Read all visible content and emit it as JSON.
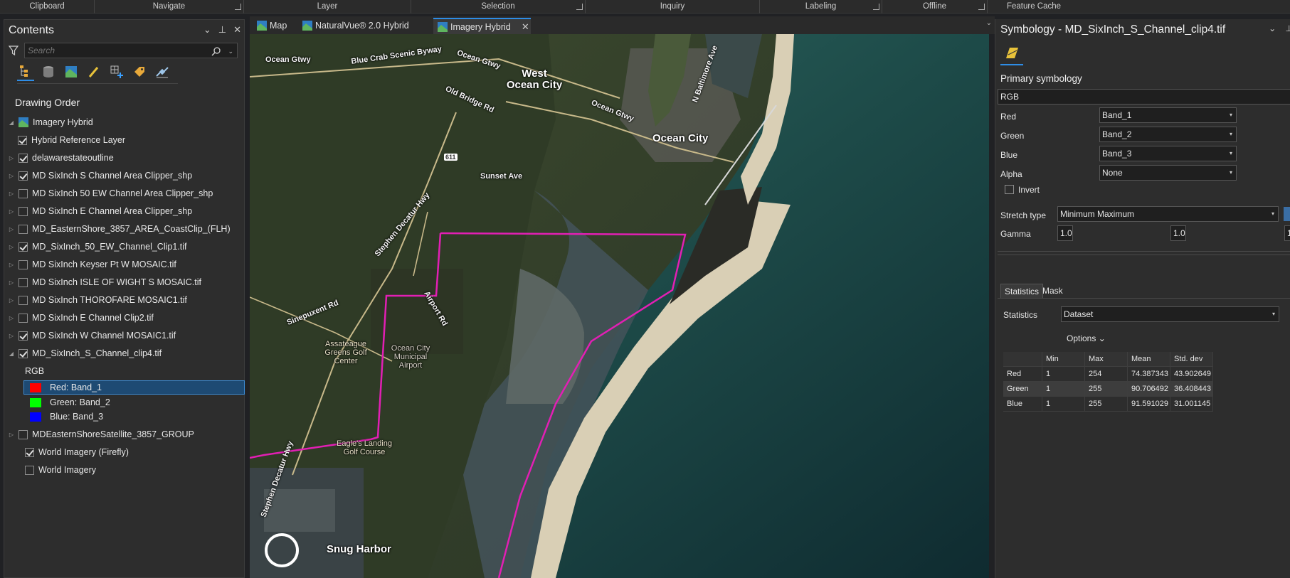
{
  "ribbon": {
    "groups": [
      "Clipboard",
      "Navigate",
      "Layer",
      "Selection",
      "Inquiry",
      "Labeling",
      "Offline",
      "Feature Cache"
    ]
  },
  "contents": {
    "title": "Contents",
    "search_placeholder": "Search",
    "heading": "Drawing Order",
    "layers": [
      {
        "label": "Imagery Hybrid",
        "kind": "map",
        "expand": "collapse"
      },
      {
        "label": "Hybrid Reference Layer",
        "checked": true
      },
      {
        "label": "delawarestateoutline",
        "checked": true,
        "expand": "expand"
      },
      {
        "label": "MD SixInch S Channel Area Clipper_shp",
        "checked": true,
        "expand": "expand"
      },
      {
        "label": "MD SixInch 50 EW Channel Area Clipper_shp",
        "checked": false,
        "expand": "expand"
      },
      {
        "label": "MD SixInch E Channel Area Clipper_shp",
        "checked": false,
        "expand": "expand"
      },
      {
        "label": "MD_EasternShore_3857_AREA_CoastClip_(FLH)",
        "checked": false,
        "expand": "expand"
      },
      {
        "label": "MD_SixInch_50_EW_Channel_Clip1.tif",
        "checked": true,
        "expand": "expand"
      },
      {
        "label": "MD SixInch Keyser Pt W MOSAIC.tif",
        "checked": false,
        "expand": "expand"
      },
      {
        "label": "MD SixInch ISLE OF WIGHT S MOSAIC.tif",
        "checked": false,
        "expand": "expand"
      },
      {
        "label": "MD SixInch THOROFARE MOSAIC1.tif",
        "checked": false,
        "expand": "expand"
      },
      {
        "label": "MD SixInch E Channel Clip2.tif",
        "checked": false,
        "expand": "expand"
      },
      {
        "label": "MD SixInch W Channel MOSAIC1.tif",
        "checked": true,
        "expand": "expand"
      },
      {
        "label": "MD_SixInch_S_Channel_clip4.tif",
        "checked": true,
        "expand": "collapse"
      }
    ],
    "rgb_label": "RGB",
    "bands": [
      {
        "label": "Red:   Band_1",
        "color": "#ff0000",
        "selected": true
      },
      {
        "label": "Green: Band_2",
        "color": "#00ff00",
        "selected": false
      },
      {
        "label": "Blue:  Band_3",
        "color": "#0000ff",
        "selected": false
      }
    ],
    "more_layers": [
      {
        "label": "MDEasternShoreSatellite_3857_GROUP",
        "checked": false,
        "expand": "expand"
      },
      {
        "label": "World Imagery (Firefly)",
        "checked": true
      },
      {
        "label": "World Imagery",
        "checked": false
      }
    ]
  },
  "map_tabs": [
    {
      "label": "Map",
      "active": false
    },
    {
      "label": "NaturalVue® 2.0 Hybrid",
      "active": false
    },
    {
      "label": "Imagery Hybrid",
      "active": true
    }
  ],
  "map_labels": {
    "ocean_gtwy_1": "Ocean Gtwy",
    "blue_crab": "Blue Crab Scenic Byway",
    "ocean_gtwy_2": "Ocean Gtwy",
    "west_ocean_city": "West Ocean City",
    "old_bridge": "Old Bridge Rd",
    "ocean_gtwy_3": "Ocean Gtwy",
    "ocean_city": "Ocean City",
    "baltimore_ave": "N Baltimore Ave",
    "route_611": "611",
    "sunset_ave": "Sunset Ave",
    "stephen_decatur": "Stephen Decatur Hwy",
    "sinepuxent": "Sinepuxent Rd",
    "airport_rd": "Airport Rd",
    "assateague_golf": "Assateague Greens Golf Center",
    "oc_airport": "Ocean City Municipal Airport",
    "eagles_landing": "Eagle's Landing Golf Course",
    "stephen_decatur_2": "Stephen Decatur Hwy",
    "snug_harbor": "Snug Harbor"
  },
  "symbology": {
    "title": "Symbology - MD_SixInch_S_Channel_clip4.tif",
    "primary_heading": "Primary symbology",
    "renderer": "RGB",
    "red_label": "Red",
    "red_value": "Band_1",
    "green_label": "Green",
    "green_value": "Band_2",
    "blue_label": "Blue",
    "blue_value": "Band_3",
    "alpha_label": "Alpha",
    "alpha_value": "None",
    "invert_label": "Invert",
    "stretch_label": "Stretch type",
    "stretch_value": "Minimum Maximum",
    "gamma_label": "Gamma",
    "gamma_1": "1.0",
    "gamma_2": "1.0",
    "gamma_3": "1",
    "tabs": [
      "Statistics",
      "Mask"
    ],
    "statistics_label": "Statistics",
    "statistics_value": "Dataset",
    "options_label": "Options",
    "stats_headers": [
      "",
      "Min",
      "Max",
      "Mean",
      "Std. dev"
    ],
    "stats_rows": [
      [
        "Red",
        "1",
        "254",
        "74.387343",
        "43.902649"
      ],
      [
        "Green",
        "1",
        "255",
        "90.706492",
        "36.408443"
      ],
      [
        "Blue",
        "1",
        "255",
        "91.591029",
        "31.001145"
      ]
    ]
  },
  "colors": {
    "accent": "#2e8de6",
    "clip_boundary": "#e21fb4",
    "selection": "#1e4a73"
  }
}
